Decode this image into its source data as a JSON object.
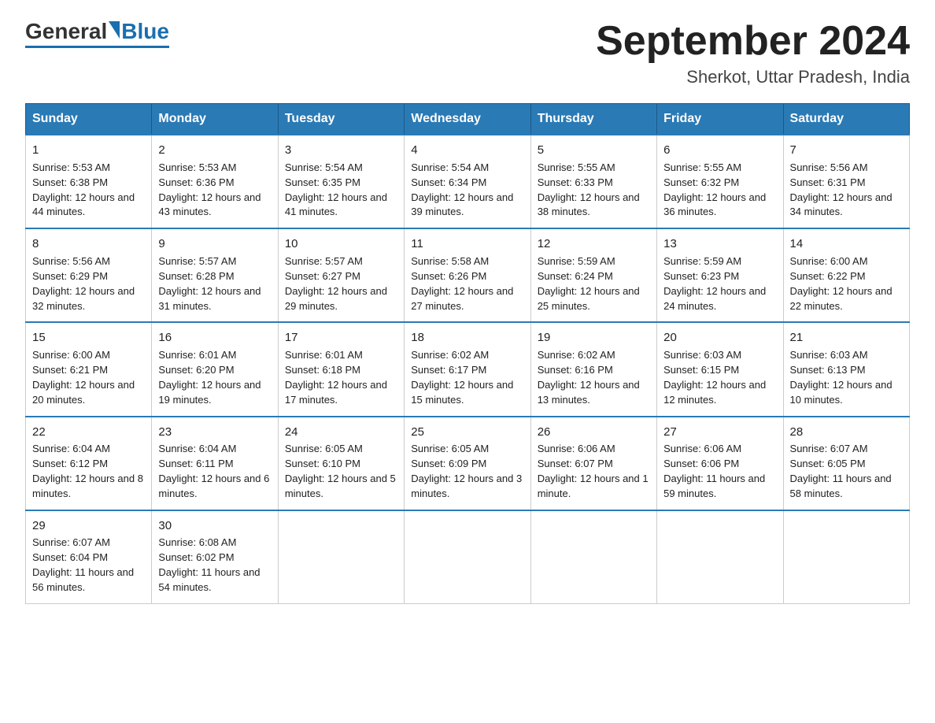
{
  "logo": {
    "general": "General",
    "blue": "Blue"
  },
  "title": "September 2024",
  "subtitle": "Sherkot, Uttar Pradesh, India",
  "days": [
    "Sunday",
    "Monday",
    "Tuesday",
    "Wednesday",
    "Thursday",
    "Friday",
    "Saturday"
  ],
  "weeks": [
    [
      {
        "num": "1",
        "sunrise": "5:53 AM",
        "sunset": "6:38 PM",
        "daylight": "12 hours and 44 minutes."
      },
      {
        "num": "2",
        "sunrise": "5:53 AM",
        "sunset": "6:36 PM",
        "daylight": "12 hours and 43 minutes."
      },
      {
        "num": "3",
        "sunrise": "5:54 AM",
        "sunset": "6:35 PM",
        "daylight": "12 hours and 41 minutes."
      },
      {
        "num": "4",
        "sunrise": "5:54 AM",
        "sunset": "6:34 PM",
        "daylight": "12 hours and 39 minutes."
      },
      {
        "num": "5",
        "sunrise": "5:55 AM",
        "sunset": "6:33 PM",
        "daylight": "12 hours and 38 minutes."
      },
      {
        "num": "6",
        "sunrise": "5:55 AM",
        "sunset": "6:32 PM",
        "daylight": "12 hours and 36 minutes."
      },
      {
        "num": "7",
        "sunrise": "5:56 AM",
        "sunset": "6:31 PM",
        "daylight": "12 hours and 34 minutes."
      }
    ],
    [
      {
        "num": "8",
        "sunrise": "5:56 AM",
        "sunset": "6:29 PM",
        "daylight": "12 hours and 32 minutes."
      },
      {
        "num": "9",
        "sunrise": "5:57 AM",
        "sunset": "6:28 PM",
        "daylight": "12 hours and 31 minutes."
      },
      {
        "num": "10",
        "sunrise": "5:57 AM",
        "sunset": "6:27 PM",
        "daylight": "12 hours and 29 minutes."
      },
      {
        "num": "11",
        "sunrise": "5:58 AM",
        "sunset": "6:26 PM",
        "daylight": "12 hours and 27 minutes."
      },
      {
        "num": "12",
        "sunrise": "5:59 AM",
        "sunset": "6:24 PM",
        "daylight": "12 hours and 25 minutes."
      },
      {
        "num": "13",
        "sunrise": "5:59 AM",
        "sunset": "6:23 PM",
        "daylight": "12 hours and 24 minutes."
      },
      {
        "num": "14",
        "sunrise": "6:00 AM",
        "sunset": "6:22 PM",
        "daylight": "12 hours and 22 minutes."
      }
    ],
    [
      {
        "num": "15",
        "sunrise": "6:00 AM",
        "sunset": "6:21 PM",
        "daylight": "12 hours and 20 minutes."
      },
      {
        "num": "16",
        "sunrise": "6:01 AM",
        "sunset": "6:20 PM",
        "daylight": "12 hours and 19 minutes."
      },
      {
        "num": "17",
        "sunrise": "6:01 AM",
        "sunset": "6:18 PM",
        "daylight": "12 hours and 17 minutes."
      },
      {
        "num": "18",
        "sunrise": "6:02 AM",
        "sunset": "6:17 PM",
        "daylight": "12 hours and 15 minutes."
      },
      {
        "num": "19",
        "sunrise": "6:02 AM",
        "sunset": "6:16 PM",
        "daylight": "12 hours and 13 minutes."
      },
      {
        "num": "20",
        "sunrise": "6:03 AM",
        "sunset": "6:15 PM",
        "daylight": "12 hours and 12 minutes."
      },
      {
        "num": "21",
        "sunrise": "6:03 AM",
        "sunset": "6:13 PM",
        "daylight": "12 hours and 10 minutes."
      }
    ],
    [
      {
        "num": "22",
        "sunrise": "6:04 AM",
        "sunset": "6:12 PM",
        "daylight": "12 hours and 8 minutes."
      },
      {
        "num": "23",
        "sunrise": "6:04 AM",
        "sunset": "6:11 PM",
        "daylight": "12 hours and 6 minutes."
      },
      {
        "num": "24",
        "sunrise": "6:05 AM",
        "sunset": "6:10 PM",
        "daylight": "12 hours and 5 minutes."
      },
      {
        "num": "25",
        "sunrise": "6:05 AM",
        "sunset": "6:09 PM",
        "daylight": "12 hours and 3 minutes."
      },
      {
        "num": "26",
        "sunrise": "6:06 AM",
        "sunset": "6:07 PM",
        "daylight": "12 hours and 1 minute."
      },
      {
        "num": "27",
        "sunrise": "6:06 AM",
        "sunset": "6:06 PM",
        "daylight": "11 hours and 59 minutes."
      },
      {
        "num": "28",
        "sunrise": "6:07 AM",
        "sunset": "6:05 PM",
        "daylight": "11 hours and 58 minutes."
      }
    ],
    [
      {
        "num": "29",
        "sunrise": "6:07 AM",
        "sunset": "6:04 PM",
        "daylight": "11 hours and 56 minutes."
      },
      {
        "num": "30",
        "sunrise": "6:08 AM",
        "sunset": "6:02 PM",
        "daylight": "11 hours and 54 minutes."
      },
      null,
      null,
      null,
      null,
      null
    ]
  ]
}
